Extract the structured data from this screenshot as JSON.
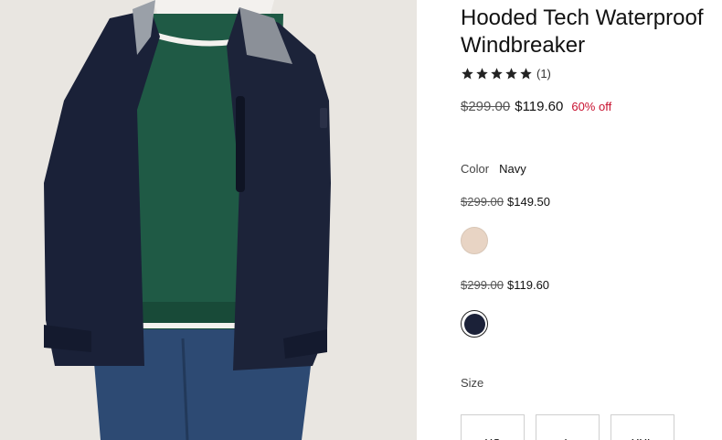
{
  "product": {
    "title": "Hooded Tech Waterproof Windbreaker",
    "rating": {
      "stars": 5,
      "review_count": "(1)"
    },
    "price": {
      "was": "$299.00",
      "now": "$119.60",
      "discount": "60% off"
    }
  },
  "color": {
    "label": "Color",
    "selected": "Navy",
    "variants": [
      {
        "was": "$299.00",
        "now": "$149.50",
        "swatch": "#e8d4c4"
      },
      {
        "was": "$299.00",
        "now": "$119.60",
        "swatch": "#1b2138"
      }
    ]
  },
  "size": {
    "label": "Size",
    "options": [
      "XS",
      "L",
      "XXL"
    ]
  },
  "colors": {
    "discount": "#c8102e",
    "text": "#111111"
  }
}
